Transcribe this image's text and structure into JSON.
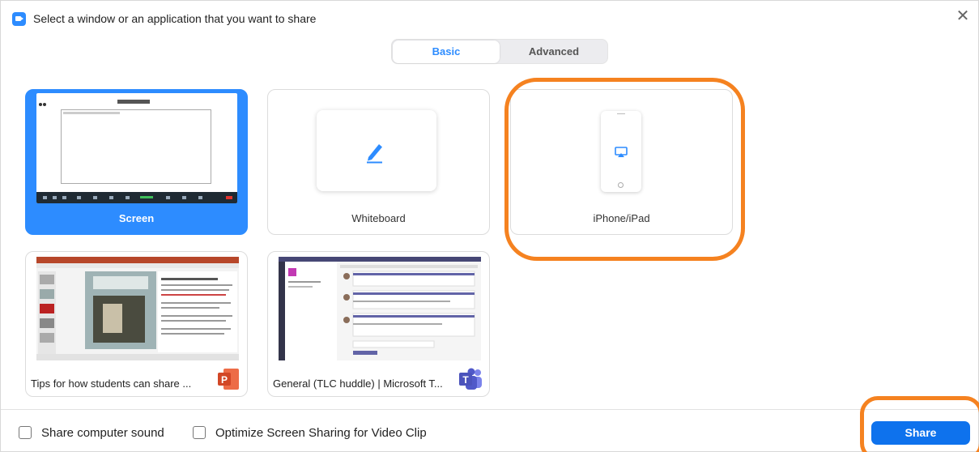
{
  "window": {
    "title": "Select a window or an application that you want to share",
    "close_glyph": "✕"
  },
  "tabs": [
    {
      "label": "Basic",
      "active": true
    },
    {
      "label": "Advanced",
      "active": false
    }
  ],
  "tiles": {
    "screen": {
      "label": "Screen",
      "selected": true
    },
    "whiteboard": {
      "label": "Whiteboard",
      "icon": "pencil-icon"
    },
    "iphone": {
      "label": "iPhone/iPad",
      "icon": "airplay-icon"
    }
  },
  "apps": [
    {
      "label": "Tips for how students can share ...",
      "app": "powerpoint",
      "badge_letter": "P"
    },
    {
      "label": "General (TLC huddle) | Microsoft T...",
      "app": "teams",
      "badge_letter": "T"
    }
  ],
  "footer": {
    "share_sound_label": "Share computer sound",
    "optimize_label": "Optimize Screen Sharing for Video Clip",
    "share_button": "Share"
  },
  "colors": {
    "accent": "#2d8cff",
    "share_button": "#0e72ed",
    "highlight": "#f58220",
    "powerpoint": "#d24726",
    "teams": "#5059c9"
  }
}
